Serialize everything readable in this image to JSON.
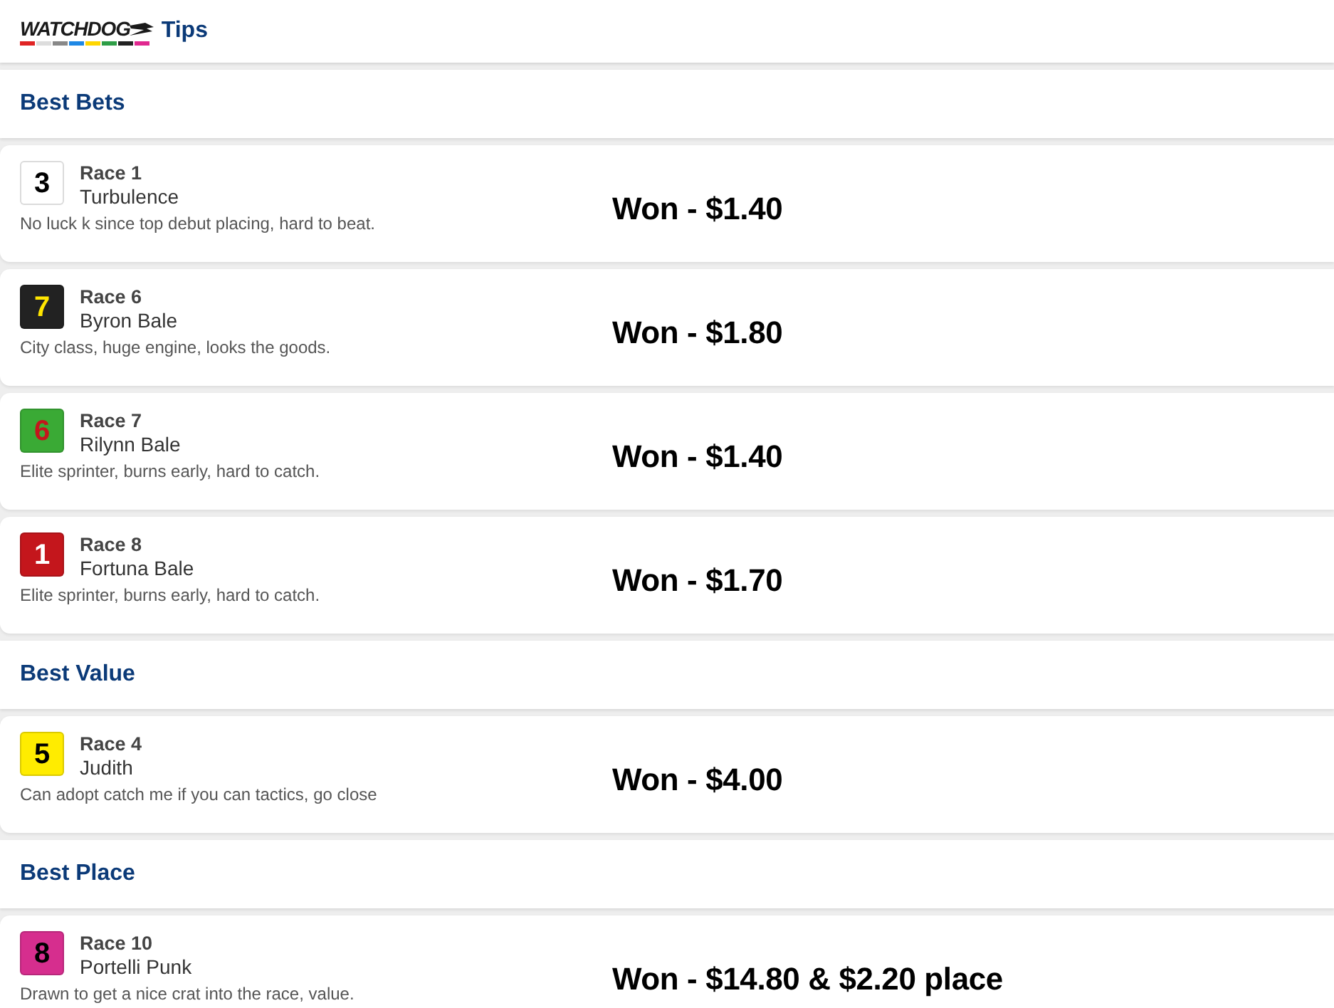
{
  "header": {
    "logo": "WATCHDOG",
    "title": "Tips"
  },
  "sections": [
    {
      "title": "Best Bets",
      "tips": [
        {
          "color": "#ffffff",
          "number": {
            "text": "3",
            "color": "#000000"
          },
          "race": "Race 1",
          "runner": "Turbulence",
          "comment": "No luck k since top debut placing, hard to beat.",
          "result": "Won - $1.40"
        },
        {
          "color": "#222222",
          "number": {
            "text": "7",
            "color": "#ffe500"
          },
          "race": "Race 6",
          "runner": "Byron Bale",
          "comment": "City class, huge engine, looks the goods.",
          "result": "Won - $1.80"
        },
        {
          "color": "#3aaa35",
          "number": {
            "text": "6",
            "color": "#c4161c"
          },
          "race": "Race 7",
          "runner": "Rilynn Bale",
          "comment": "Elite sprinter, burns early, hard to catch.",
          "result": "Won - $1.40"
        },
        {
          "color": "#c4161c",
          "number": {
            "text": "1",
            "color": "#ffffff"
          },
          "race": "Race 8",
          "runner": "Fortuna Bale",
          "comment": "Elite sprinter, burns early, hard to catch.",
          "result": "Won - $1.70"
        }
      ]
    },
    {
      "title": "Best Value",
      "tips": [
        {
          "color": "#ffec00",
          "number": {
            "text": "5",
            "color": "#000000"
          },
          "race": "Race 4",
          "runner": "Judith",
          "comment": "Can adopt catch me if you can tactics, go close",
          "result": "Won - $4.00"
        }
      ]
    },
    {
      "title": "Best Place",
      "tips": [
        {
          "color": "#d62e8e",
          "number": {
            "text": "8",
            "color": "#000000"
          },
          "race": "Race 10",
          "runner": "Portelli Punk",
          "comment": "Drawn to get a nice crat into the race, value.",
          "result": "Won - $14.80 & $2.20 place"
        }
      ]
    }
  ]
}
